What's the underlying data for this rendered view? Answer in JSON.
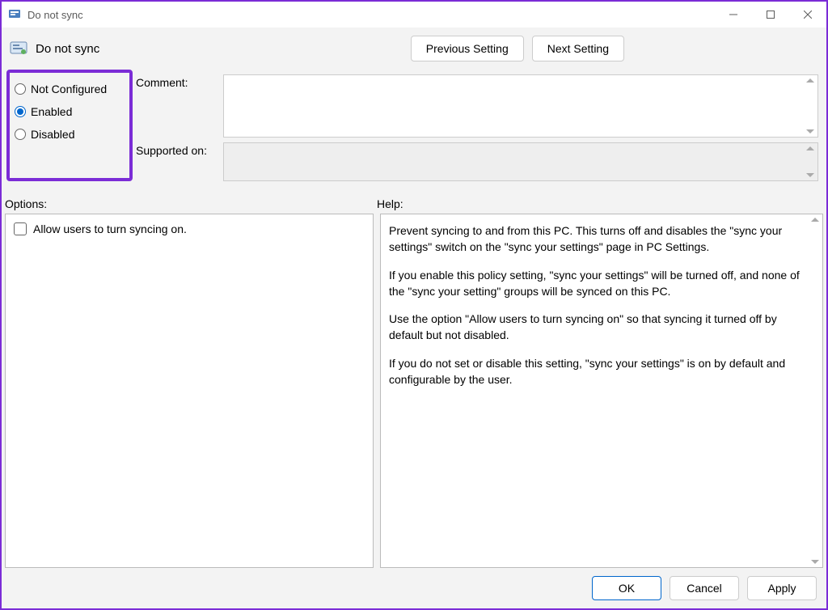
{
  "window": {
    "title": "Do not sync"
  },
  "header": {
    "policy_name": "Do not sync",
    "prev_label": "Previous Setting",
    "next_label": "Next Setting"
  },
  "radios": {
    "not_configured": "Not Configured",
    "enabled": "Enabled",
    "disabled": "Disabled",
    "selected": "enabled"
  },
  "fields": {
    "comment_label": "Comment:",
    "comment_value": "",
    "supported_label": "Supported on:",
    "supported_value": ""
  },
  "sections": {
    "options_label": "Options:",
    "help_label": "Help:"
  },
  "options": {
    "allow_sync_checkbox_label": "Allow users to turn syncing on.",
    "allow_sync_checked": false
  },
  "help": {
    "p1": "Prevent syncing to and from this PC.  This turns off and disables the \"sync your settings\" switch on the \"sync your settings\" page in PC Settings.",
    "p2": "If you enable this policy setting, \"sync your settings\" will be turned off, and none of the \"sync your setting\" groups will be synced on this PC.",
    "p3": "Use the option \"Allow users to turn syncing on\" so that syncing it turned off by default but not disabled.",
    "p4": "If you do not set or disable this setting, \"sync your settings\" is on by default and configurable by the user."
  },
  "footer": {
    "ok": "OK",
    "cancel": "Cancel",
    "apply": "Apply"
  }
}
